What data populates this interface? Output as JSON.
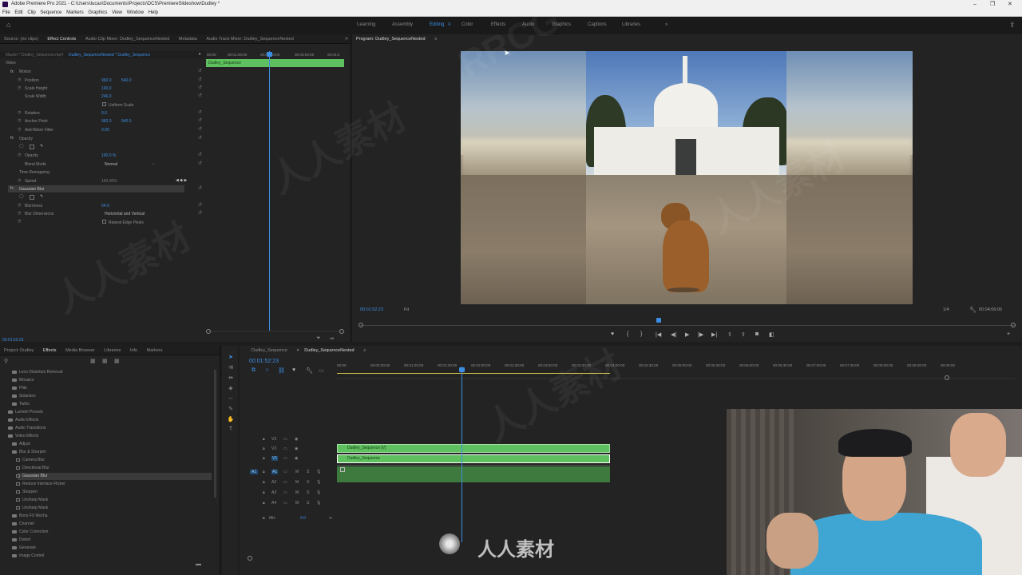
{
  "window": {
    "title": "Adobe Premiere Pro 2021 - C:\\Users\\lucas\\Documents\\Projects\\DCS\\PremiereSlideshow\\Dudley *"
  },
  "menu": [
    "File",
    "Edit",
    "Clip",
    "Sequence",
    "Markers",
    "Graphics",
    "View",
    "Window",
    "Help"
  ],
  "workspaces": [
    "Learning",
    "Assembly",
    "Editing",
    "Color",
    "Effects",
    "Audio",
    "Graphics",
    "Captions",
    "Libraries"
  ],
  "workspace_more": "»",
  "source_panel": {
    "tabs": [
      "Source: (no clips)",
      "Effect Controls",
      "Audio Clip Mixer: Dudley_SequenceNested",
      "Metadata",
      "Audio Track Mixer: Dudley_SequenceNested"
    ],
    "path": "Master * Dudley_Sequence.mp4",
    "sequence_path": "Dudley_SequenceNested * Dudley_Sequence",
    "ruler": [
      "00:00",
      "00:01:00:00",
      "00:02:00:00",
      "00:03:00:00",
      "00:04:0"
    ],
    "clip_label": "Dudley_Sequence",
    "section_video": "Video",
    "motion": {
      "label": "Motion",
      "position_label": "Position",
      "position_x": "960.0",
      "position_y": "540.0",
      "scale_height_label": "Scale Height",
      "scale_height": "100.0",
      "scale_width_label": "Scale Width",
      "scale_width": "246.0",
      "uniform_scale_label": "Uniform Scale",
      "rotation_label": "Rotation",
      "rotation": "0.0",
      "anchor_label": "Anchor Point",
      "anchor_x": "960.0",
      "anchor_y": "540.0",
      "antiflicker_label": "Anti-flicker Filter",
      "antiflicker": "0.00"
    },
    "opacity": {
      "label": "Opacity",
      "opacity_label": "Opacity",
      "opacity": "100.0 %",
      "blend_label": "Blend Mode",
      "blend": "Normal"
    },
    "time_remap": {
      "label": "Time Remapping",
      "speed_label": "Speed",
      "speed": "100.00%"
    },
    "gaussian": {
      "label": "Gaussian Blur",
      "blurriness_label": "Blurriness",
      "blurriness": "54.0",
      "dimensions_label": "Blur Dimensions",
      "dimensions": "Horizontal and Vertical",
      "repeat_label": "Repeat Edge Pixels"
    },
    "timecode": "00:01:52:23"
  },
  "program": {
    "tab": "Program: Dudley_SequenceNested",
    "timecode": "00:01:52:23",
    "fit": "Fit",
    "quality": "1/4",
    "duration": "00:04:06:05"
  },
  "project_panel": {
    "tabs": [
      "Project: Dudley",
      "Effects",
      "Media Browser",
      "Libraries",
      "Info",
      "Markers"
    ],
    "items": [
      {
        "label": "Lens Distortion Removal",
        "type": "folder",
        "indent": 2
      },
      {
        "label": "Mosaics",
        "type": "folder",
        "indent": 2
      },
      {
        "label": "Pitts",
        "type": "folder",
        "indent": 2
      },
      {
        "label": "Solarizes",
        "type": "folder",
        "indent": 2
      },
      {
        "label": "Twirls",
        "type": "folder",
        "indent": 2
      },
      {
        "label": "Lumetri Presets",
        "type": "folder",
        "indent": 1
      },
      {
        "label": "Audio Effects",
        "type": "folder",
        "indent": 1
      },
      {
        "label": "Audio Transitions",
        "type": "folder",
        "indent": 1
      },
      {
        "label": "Video Effects",
        "type": "folder",
        "indent": 1
      },
      {
        "label": "Adjust",
        "type": "folder",
        "indent": 2
      },
      {
        "label": "Blur & Sharpen",
        "type": "folder",
        "indent": 2
      },
      {
        "label": "Camera Blur",
        "type": "fx",
        "indent": 3
      },
      {
        "label": "Directional Blur",
        "type": "fx",
        "indent": 3
      },
      {
        "label": "Gaussian Blur",
        "type": "fx",
        "indent": 3,
        "selected": true
      },
      {
        "label": "Reduce Interlace Flicker",
        "type": "fx",
        "indent": 3
      },
      {
        "label": "Sharpen",
        "type": "fx",
        "indent": 3
      },
      {
        "label": "Unsharp Mask",
        "type": "fx",
        "indent": 3
      },
      {
        "label": "Unsharp Mask",
        "type": "fx",
        "indent": 3
      },
      {
        "label": "Boris FX Mocha",
        "type": "folder",
        "indent": 2
      },
      {
        "label": "Channel",
        "type": "folder",
        "indent": 2
      },
      {
        "label": "Color Correction",
        "type": "folder",
        "indent": 2
      },
      {
        "label": "Distort",
        "type": "folder",
        "indent": 2
      },
      {
        "label": "Generate",
        "type": "folder",
        "indent": 2
      },
      {
        "label": "Image Control",
        "type": "folder",
        "indent": 2
      }
    ]
  },
  "timeline": {
    "tabs": [
      "Dudley_Sequence",
      "Dudley_SequenceNested"
    ],
    "timecode": "00:01:52:23",
    "ruler": [
      "00:00",
      "00:00:30:00",
      "00:01:00:00",
      "00:01:30:00",
      "00:02:00:00",
      "00:02:30:00",
      "00:03:00:00",
      "00:03:30:00",
      "00:04:00:00",
      "00:04:30:00",
      "00:05:00:00",
      "00:05:30:00",
      "00:06:00:00",
      "00:06:30:00",
      "00:07:00:00",
      "00:07:30:00",
      "00:08:00:00",
      "00:08:30:00",
      "00:09:00"
    ],
    "video_tracks": [
      "V3",
      "V2",
      "V1"
    ],
    "audio_tracks": [
      "A1",
      "A2",
      "A3",
      "A4"
    ],
    "mix_label": "Mix",
    "mix_value": "0.0",
    "clip_v2": "Dudley_Sequence [V]",
    "clip_v1": "Dudley_Sequence"
  },
  "watermark": "人人素材"
}
